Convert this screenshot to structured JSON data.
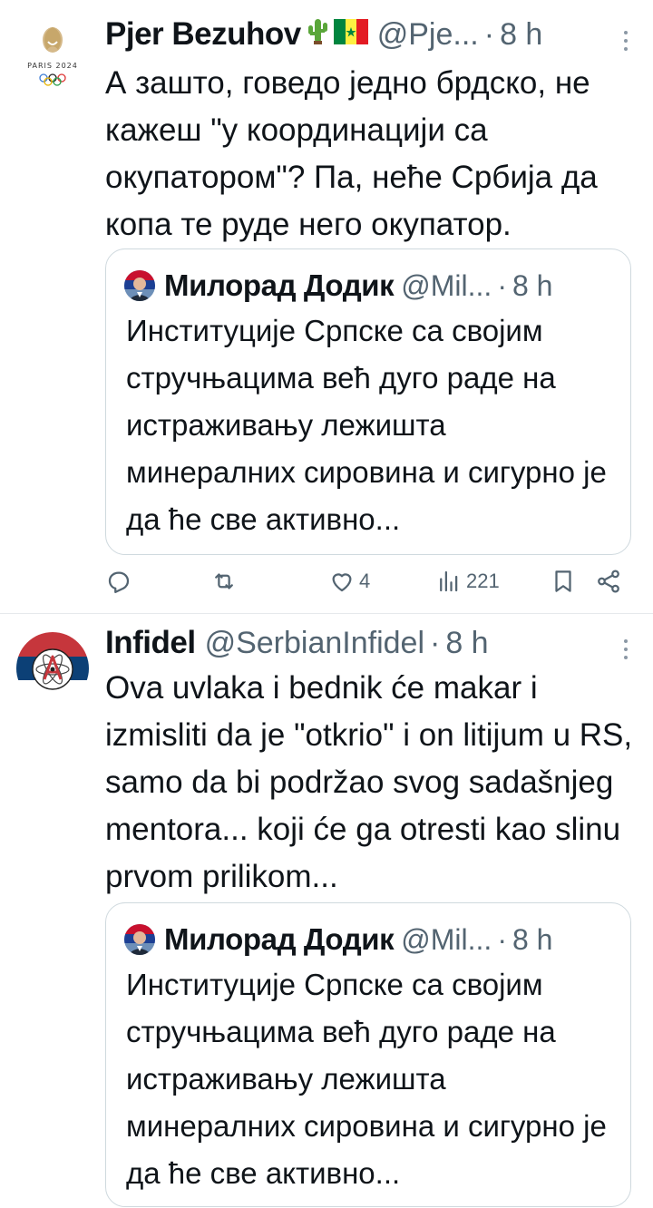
{
  "tweets": [
    {
      "author_name": "Pjer Bezuhov",
      "author_badges": [
        "cactus-icon",
        "senegal-flag-icon"
      ],
      "handle": "@Pje...",
      "separator": "·",
      "time": "8 h",
      "avatar_label": "PARIS 2024",
      "text": "А зашто, говедо једно брдско, не кажеш \"у координацији са окупатором\"? Па, неће Србија да копа те руде него окупатор.",
      "quote": {
        "author_name": "Милорад Додик",
        "handle": "@Mil...",
        "separator": "·",
        "time": "8 h",
        "text": "Институције Српске са својим стручњацима већ дуго раде на истраживању лежишта минералних сировина и сигурно је да ће све активно..."
      },
      "actions": {
        "reply_count": "",
        "retweet_count": "",
        "like_count": "4",
        "view_count": "221"
      }
    },
    {
      "author_name": "Infidel",
      "handle": "@SerbianInfidel",
      "separator": "·",
      "time": "8 h",
      "text": "Ova uvlaka i bednik će makar i izmisliti da je \"otkrio\" i on litijum u RS, samo da bi podržao svog sadašnjeg mentora... koji će ga otresti kao slinu prvom prilikom...",
      "quote": {
        "author_name": "Милорад Додик",
        "handle": "@Mil...",
        "separator": "·",
        "time": "8 h",
        "text": "Институције Српске са својим стручњацима већ дуго раде на истраживању лежишта минералних сировина и сигурно је да ће све активно..."
      }
    }
  ],
  "colors": {
    "text": "#0f1419",
    "secondary": "#536471",
    "border": "#cfd9de",
    "divider": "#e6e9ec"
  }
}
